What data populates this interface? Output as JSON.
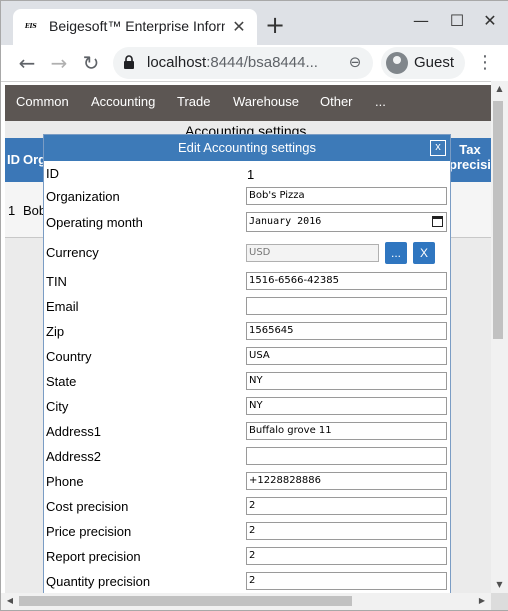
{
  "browser": {
    "tab_title": "Beigesoft™ Enterprise Information System",
    "favicon_text": "EIS",
    "close_tab_glyph": "✕",
    "new_tab_glyph": "+",
    "minimize_glyph": "—",
    "maximize_glyph": "☐",
    "close_window_glyph": "✕",
    "back_glyph": "←",
    "forward_glyph": "→",
    "reload_glyph": "↻",
    "url_host": "localhost",
    "url_rest": ":8444/bsa8444...",
    "zoom_glyph": "⊖",
    "profile_name": "Guest",
    "menu_glyph": "⋮"
  },
  "app_menu": {
    "items": [
      "Common",
      "Accounting",
      "Trade",
      "Warehouse",
      "Other",
      "..."
    ]
  },
  "background_page": {
    "title": "Accounting settings",
    "header_id": "ID",
    "header_org": "Org",
    "header_tax": "Tax precision",
    "row_id": "1",
    "row_org": "Bob"
  },
  "dialog": {
    "title": "Edit Accounting settings",
    "close_label": "x",
    "id_label": "ID",
    "id_value": "1",
    "fields": [
      {
        "label": "Organization",
        "value": "Bob's Pizza"
      },
      {
        "label": "Operating month",
        "value": "January  2016"
      },
      {
        "label": "Currency",
        "value": "USD"
      },
      {
        "label": "TIN",
        "value": "1516-6566-42385"
      },
      {
        "label": "Email",
        "value": ""
      },
      {
        "label": "Zip",
        "value": "1565645"
      },
      {
        "label": "Country",
        "value": "USA"
      },
      {
        "label": "State",
        "value": "NY"
      },
      {
        "label": "City",
        "value": "NY"
      },
      {
        "label": "Address1",
        "value": "Buffalo grove 11"
      },
      {
        "label": "Address2",
        "value": ""
      },
      {
        "label": "Phone",
        "value": "+1228828886"
      },
      {
        "label": "Cost precision",
        "value": "2"
      },
      {
        "label": "Price precision",
        "value": "2"
      },
      {
        "label": "Report precision",
        "value": "2"
      },
      {
        "label": "Quantity precision",
        "value": "2"
      }
    ],
    "currency_pick_label": "...",
    "currency_clear_label": "X"
  },
  "colors": {
    "app_nav": "#5c5653",
    "dialog_header": "#3d7ab8",
    "button_blue": "#2f76c0"
  }
}
